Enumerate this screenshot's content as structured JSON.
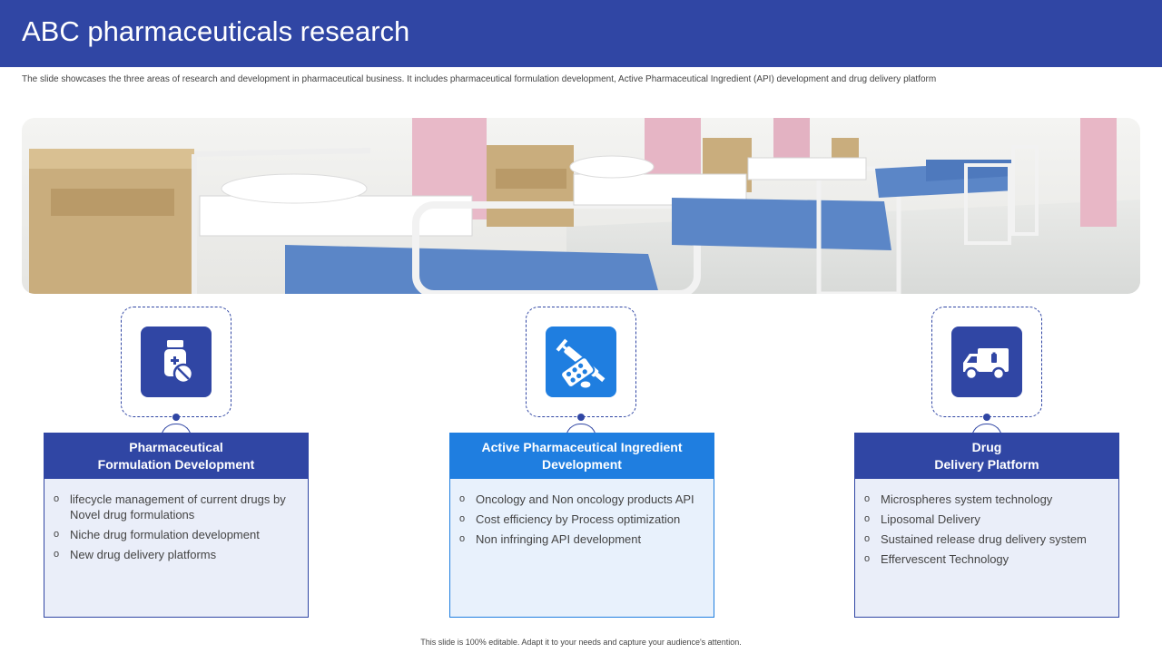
{
  "slide": {
    "title": "ABC pharmaceuticals research",
    "subtitle": "The slide showcases the three areas of research and development in pharmaceutical business. It includes pharmaceutical formulation development, Active Pharmaceutical Ingredient (API) development and drug delivery platform",
    "footer": "This slide is 100% editable. Adapt it to your needs and capture your audience's attention."
  },
  "colors": {
    "primary": "#3046a4",
    "accent": "#1f7ee0",
    "card_bg": "#eaeef9"
  },
  "banner": {
    "icon": "hospital-ward-photo"
  },
  "sections": [
    {
      "icon": "medicine-bottle-icon",
      "title_line1": "Pharmaceutical",
      "title_line2": "Formulation Development",
      "items": [
        "lifecycle management of current drugs by Novel drug formulations",
        "Niche drug formulation development",
        "New drug delivery platforms"
      ]
    },
    {
      "icon": "syringe-pills-icon",
      "title_line1": "Active Pharmaceutical Ingredient",
      "title_line2": "Development",
      "items": [
        "Oncology and Non oncology products API",
        "Cost efficiency by Process optimization",
        "Non infringing API development"
      ]
    },
    {
      "icon": "delivery-truck-icon",
      "title_line1": "Drug",
      "title_line2": "Delivery Platform",
      "items": [
        "Microspheres system technology",
        "Liposomal Delivery",
        "Sustained release drug delivery system",
        "Effervescent Technology"
      ]
    }
  ]
}
